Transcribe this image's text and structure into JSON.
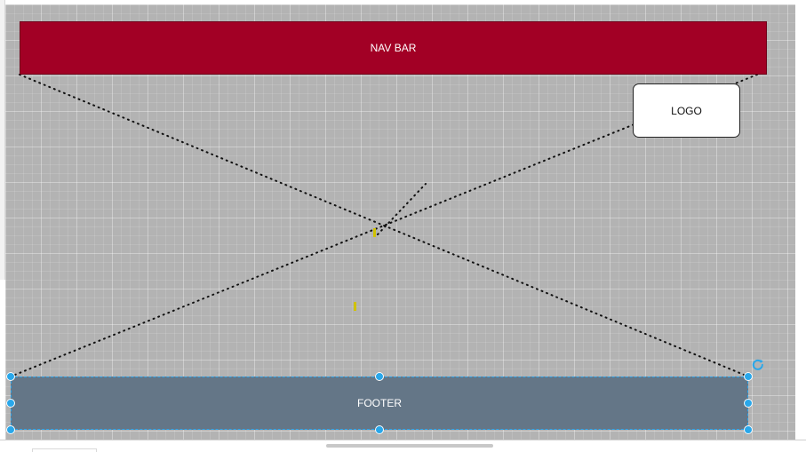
{
  "diagram": {
    "nav_bar": {
      "label": "NAV BAR",
      "fill_color": "#a20025"
    },
    "logo": {
      "label": "LOGO",
      "fill_color": "#ffffff"
    },
    "footer": {
      "label": "FOOTER",
      "fill_color": "#647687",
      "selection_color": "#29a7ea"
    },
    "connector_style": "dotted"
  },
  "icons": {
    "rotate": "rotate-icon",
    "marker": "yellow-marker"
  }
}
